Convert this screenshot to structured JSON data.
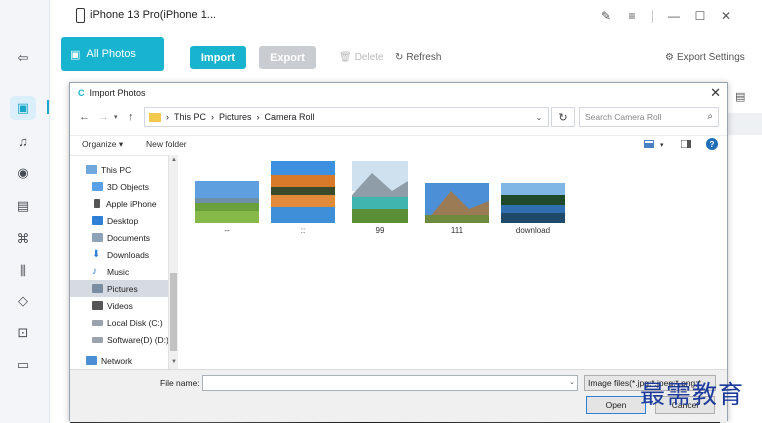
{
  "titlebar": {
    "device_name": "iPhone 13 Pro(iPhone 1..."
  },
  "toolbar": {
    "all_photos": "All Photos",
    "import": "Import",
    "export": "Export",
    "delete": "Delete",
    "refresh": "Refresh",
    "export_settings": "Export Settings"
  },
  "dialog": {
    "title": "Import Photos",
    "path": [
      "This PC",
      "Pictures",
      "Camera Roll"
    ],
    "search_placeholder": "Search Camera Roll",
    "organize": "Organize ▾",
    "new_folder": "New folder",
    "nav_items": [
      {
        "label": "This PC",
        "icon": "computer-icon"
      },
      {
        "label": "3D Objects",
        "icon": "cube-icon"
      },
      {
        "label": "Apple iPhone",
        "icon": "phone-icon"
      },
      {
        "label": "Desktop",
        "icon": "desktop-icon"
      },
      {
        "label": "Documents",
        "icon": "documents-icon"
      },
      {
        "label": "Downloads",
        "icon": "download-icon"
      },
      {
        "label": "Music",
        "icon": "music-icon"
      },
      {
        "label": "Pictures",
        "icon": "pictures-icon",
        "selected": true
      },
      {
        "label": "Videos",
        "icon": "video-icon"
      },
      {
        "label": "Local Disk (C:)",
        "icon": "disk-icon"
      },
      {
        "label": "Software(D) (D:)",
        "icon": "disk-icon"
      },
      {
        "label": "Network",
        "icon": "network-icon"
      }
    ],
    "files": [
      {
        "name": "--"
      },
      {
        "name": "::"
      },
      {
        "name": "99"
      },
      {
        "name": "111"
      },
      {
        "name": "download"
      }
    ],
    "file_name_label": "File name:",
    "file_name_value": "",
    "file_filter": "Image files(*.jpg;*.jpeg;*.png;*",
    "open": "Open",
    "cancel": "Cancel"
  },
  "watermark": "最需教育",
  "colors": {
    "accent": "#18b4cf",
    "disabled": "#c9ccd1"
  }
}
